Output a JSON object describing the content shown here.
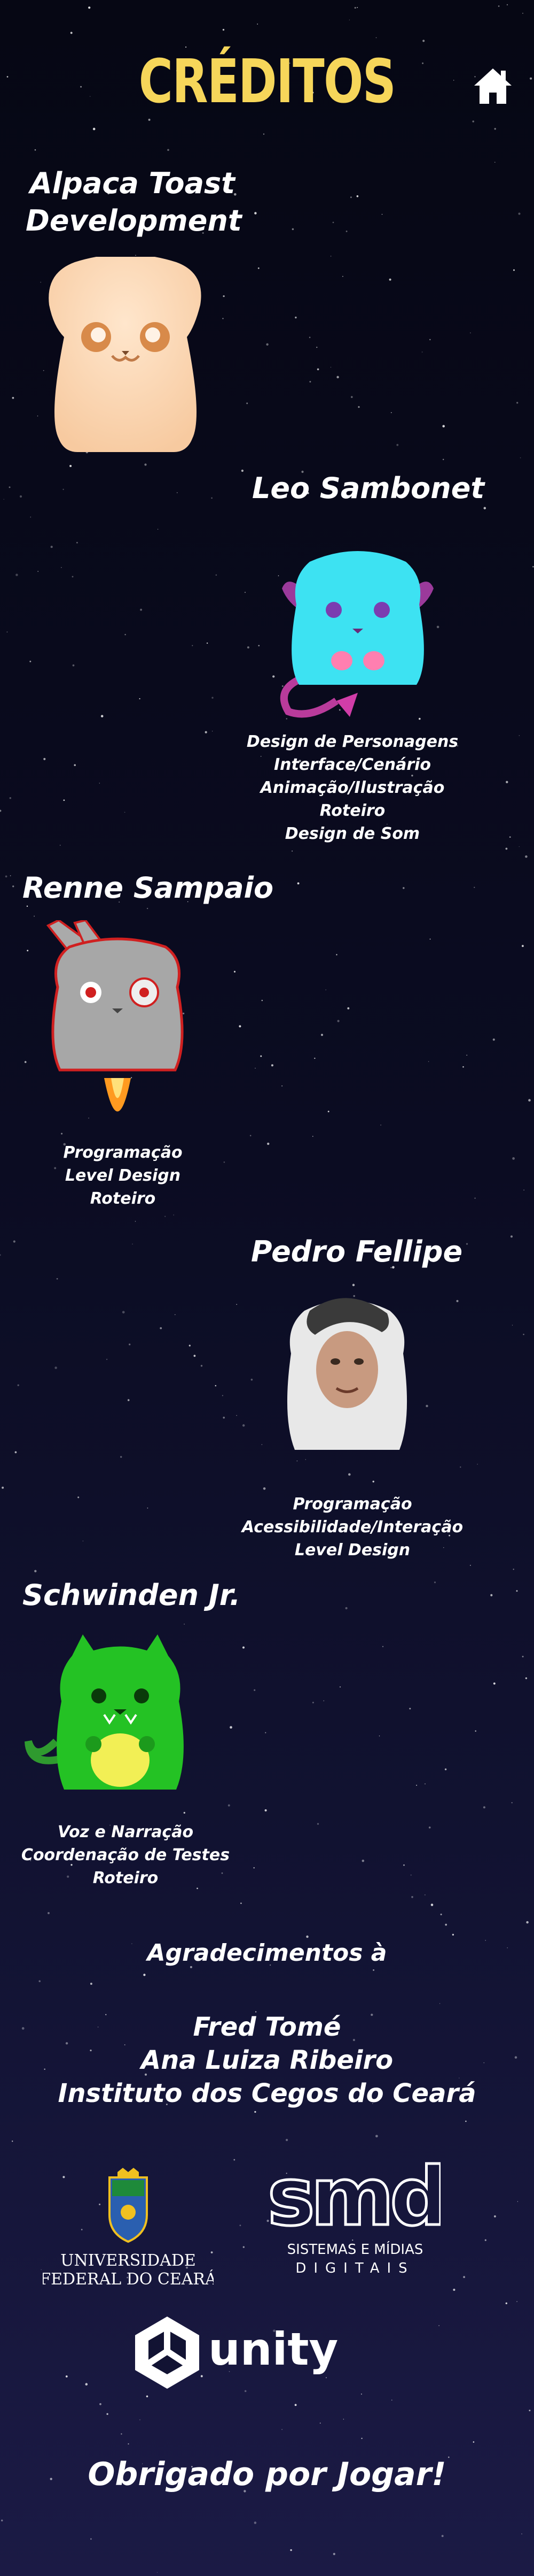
{
  "header": {
    "title": "CRÉDITOS",
    "home_icon": "home-icon"
  },
  "colors": {
    "title": "#f6d65a",
    "text": "#ffffff",
    "background_top": "#060714",
    "background_bottom": "#1b1a45"
  },
  "studio": {
    "line1": "Alpaca Toast",
    "line2": "Development"
  },
  "members": [
    {
      "name": "Leo Sambonet",
      "roles": [
        "Design de Personagens",
        "Interface/Cenário",
        "Animação/Ilustração",
        "Roteiro",
        "Design de Som"
      ]
    },
    {
      "name": "Renne Sampaio",
      "roles": [
        "Programação",
        "Level Design",
        "Roteiro"
      ]
    },
    {
      "name": "Pedro Fellipe",
      "roles": [
        "Programação",
        "Acessibilidade/Interação",
        "Level Design"
      ]
    },
    {
      "name": "Schwinden Jr.",
      "roles": [
        "Voz e Narração",
        "Coordenação de Testes",
        "Roteiro"
      ]
    }
  ],
  "thanks": {
    "heading": "Agradecimentos à",
    "names": [
      "Fred Tomé",
      "Ana Luiza Ribeiro",
      "Instituto dos Cegos do Ceará"
    ]
  },
  "logos": {
    "ufc_line1": "UNIVERSIDADE",
    "ufc_line2": "FEDERAL DO CEARÁ",
    "smd_mark": "smd",
    "smd_line1": "SISTEMAS E MÍDIAS",
    "smd_line2": "DIGITAIS",
    "unity": "unity"
  },
  "footer": {
    "text": "Obrigado por Jogar!"
  }
}
